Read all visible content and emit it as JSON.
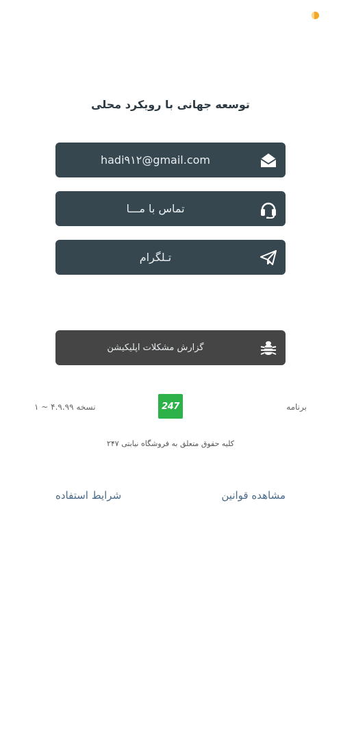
{
  "header": {
    "title": "توسعه جهانی با رویکرد محلی"
  },
  "buttons": {
    "email": {
      "label": "hadi۹۱۲@gmail.com",
      "icon": "envelope-open-icon"
    },
    "contact": {
      "label": "تماس با مـــا",
      "icon": "headset-icon"
    },
    "telegram": {
      "label": "تـلگرام",
      "icon": "paper-plane-icon"
    },
    "bug_report": {
      "label": "گزارش مشکلات اپلیکیشن",
      "icon": "bug-icon"
    }
  },
  "version_info": {
    "app_label": "برنامه",
    "version_text": "نسخه ۴.۹.۹۹ ~ ۱",
    "logo_text": "247"
  },
  "copyright": "کلیه حقوق متعلق به فروشگاه نیابتی ۲۴۷",
  "links": {
    "rules": "مشاهده قوانین",
    "terms": "شرایط استفاده"
  },
  "colors": {
    "button_dark": "#37474f",
    "bug_button": "#454545",
    "link": "#4a6b8a",
    "logo_green": "#2db24a",
    "status_dot": "#f3a72a"
  }
}
